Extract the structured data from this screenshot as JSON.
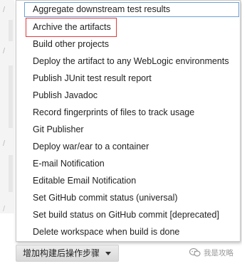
{
  "menu": {
    "items": [
      {
        "label": "Aggregate downstream test results",
        "state": "focused"
      },
      {
        "label": "Archive the artifacts",
        "state": "highlighted"
      },
      {
        "label": "Build other projects",
        "state": "normal"
      },
      {
        "label": "Deploy the artifact to any WebLogic environments",
        "state": "normal"
      },
      {
        "label": "Publish JUnit test result report",
        "state": "normal"
      },
      {
        "label": "Publish Javadoc",
        "state": "normal"
      },
      {
        "label": "Record fingerprints of files to track usage",
        "state": "normal"
      },
      {
        "label": "Git Publisher",
        "state": "normal"
      },
      {
        "label": "Deploy war/ear to a container",
        "state": "normal"
      },
      {
        "label": "E-mail Notification",
        "state": "normal"
      },
      {
        "label": "Editable Email Notification",
        "state": "normal"
      },
      {
        "label": "Set GitHub commit status (universal)",
        "state": "normal"
      },
      {
        "label": "Set build status on GitHub commit [deprecated]",
        "state": "normal"
      },
      {
        "label": "Delete workspace when build is done",
        "state": "normal"
      }
    ]
  },
  "add_step_button": {
    "label": "增加构建后操作步骤"
  },
  "watermark": {
    "text": "我是攻略"
  },
  "colors": {
    "focus_border": "#6fa2d6",
    "highlight_border": "#e23b3b",
    "menu_text": "#222222"
  }
}
